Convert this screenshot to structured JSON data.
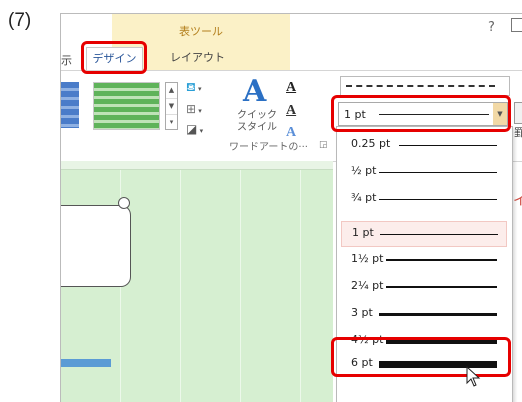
{
  "step": "(7)",
  "ribbon": {
    "context_group": "表ツール",
    "help": "?",
    "tabs": {
      "left_clipped": "示",
      "design": "デザイン",
      "layout": "レイアウト"
    },
    "wordart": {
      "quick_style_line1": "クイック",
      "quick_style_line2": "スタイル",
      "group_label": "ワードアートの···",
      "text_fill_glyph": "A",
      "text_outline_glyph": "A",
      "text_effect_glyph": "A"
    },
    "pen_weight_current": "1 pt",
    "side_clip": "罫",
    "accent_clip": "イ"
  },
  "weight_dropdown": {
    "options": [
      {
        "label": "0.25 pt",
        "weight": 0.25
      },
      {
        "label": "½ pt",
        "weight": 0.5
      },
      {
        "label": "¾ pt",
        "weight": 0.75
      },
      {
        "label": "1 pt",
        "weight": 1,
        "selected": true
      },
      {
        "label": "1½ pt",
        "weight": 1.5
      },
      {
        "label": "2¼ pt",
        "weight": 2.25
      },
      {
        "label": "3 pt",
        "weight": 3
      },
      {
        "label": "4½ pt",
        "weight": 4.5
      },
      {
        "label": "6 pt",
        "weight": 6
      }
    ]
  },
  "colors": {
    "highlight": "#e60000",
    "accent": "#2b579a",
    "context_tab_bg": "#fbf1c7",
    "document_bg": "#d6efd1"
  }
}
